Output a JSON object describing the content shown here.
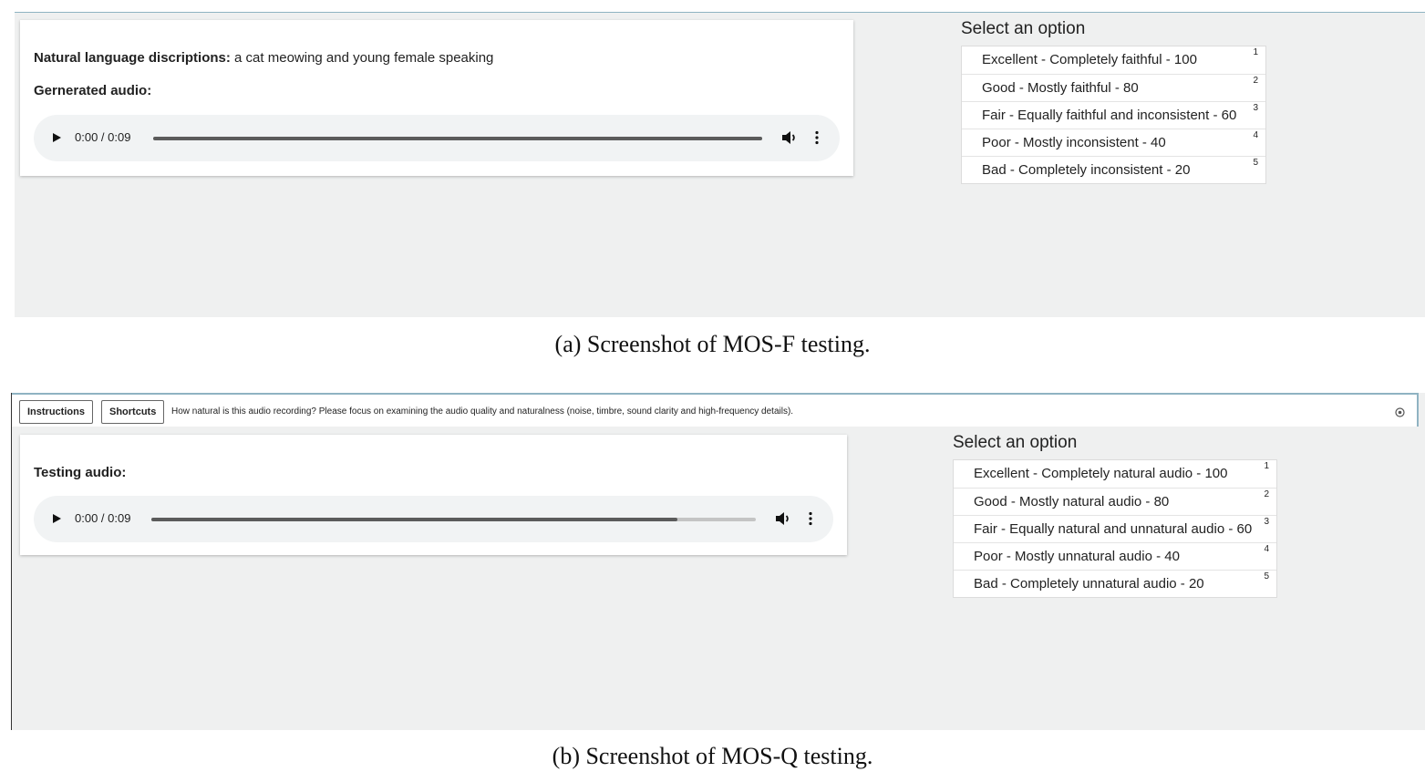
{
  "panel_a": {
    "description_label": "Natural language discriptions:",
    "description_text": "a cat meowing and young female speaking",
    "audio_label": "Gernerated audio:",
    "player": {
      "time": "0:00 / 0:09",
      "progress": 1.0
    },
    "options_title": "Select an option",
    "options": [
      {
        "label": "Excellent - Completely faithful - 100",
        "key": "1"
      },
      {
        "label": "Good - Mostly faithful - 80",
        "key": "2"
      },
      {
        "label": "Fair - Equally faithful and inconsistent - 60",
        "key": "3"
      },
      {
        "label": "Poor - Mostly inconsistent - 40",
        "key": "4"
      },
      {
        "label": "Bad - Completely inconsistent - 20",
        "key": "5"
      }
    ],
    "caption": "(a)  Screenshot of MOS-F testing."
  },
  "panel_b": {
    "toolbar": {
      "instructions_label": "Instructions",
      "shortcuts_label": "Shortcuts",
      "prompt_text": "How natural is this audio recording? Please focus on examining the audio quality and naturalness (noise, timbre, sound clarity and high-frequency details)."
    },
    "audio_label": "Testing audio:",
    "player": {
      "time": "0:00 / 0:09",
      "progress": 0.87
    },
    "options_title": "Select an option",
    "options": [
      {
        "label": "Excellent - Completely natural audio - 100",
        "key": "1"
      },
      {
        "label": "Good - Mostly natural audio - 80",
        "key": "2"
      },
      {
        "label": "Fair - Equally natural and unnatural audio - 60",
        "key": "3"
      },
      {
        "label": "Poor - Mostly unnatural audio - 40",
        "key": "4"
      },
      {
        "label": "Bad - Completely unnatural audio - 20",
        "key": "5"
      }
    ],
    "caption": "(b)  Screenshot of MOS-Q testing."
  },
  "icons": [
    "play-icon",
    "volume-icon",
    "more-options-icon",
    "settings-icon"
  ]
}
